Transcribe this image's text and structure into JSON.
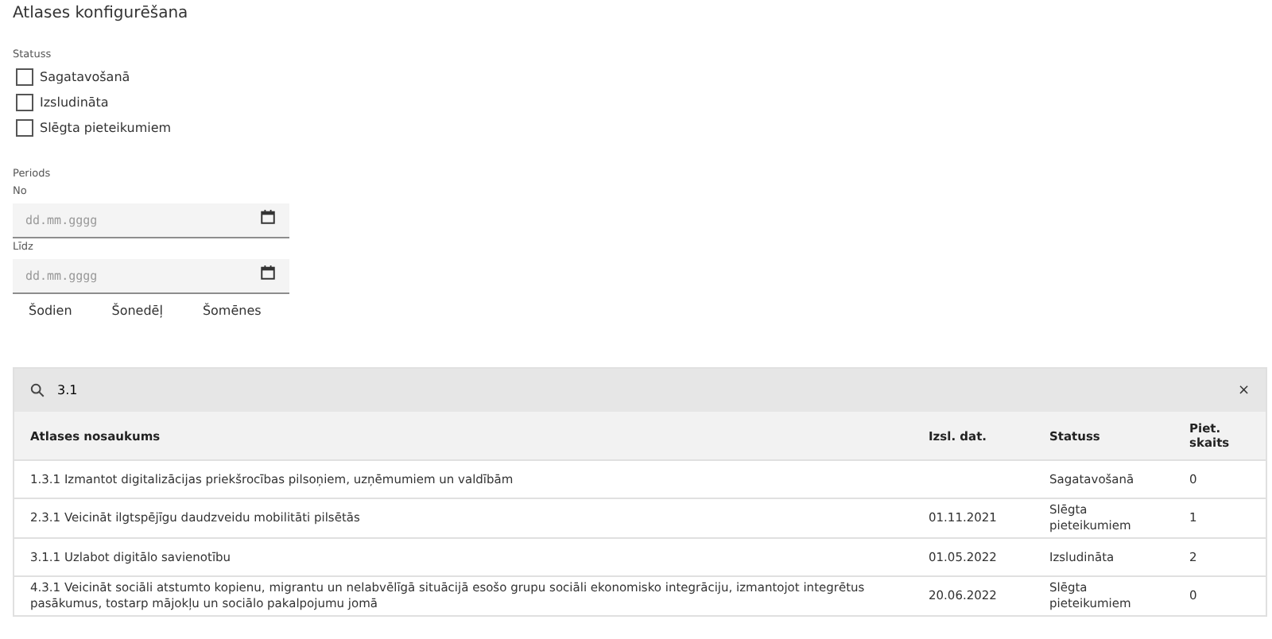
{
  "title": "Atlases konfigurēšana",
  "status_filter": {
    "label": "Statuss",
    "options": [
      {
        "label": "Sagatavošanā",
        "checked": false
      },
      {
        "label": "Izsludināta",
        "checked": false
      },
      {
        "label": "Slēgta pieteikumiem",
        "checked": false
      }
    ]
  },
  "period": {
    "label": "Periods",
    "fields": [
      {
        "label": "No",
        "placeholder": "dd.mm.gggg"
      },
      {
        "label": "Līdz",
        "placeholder": "dd.mm.gggg"
      }
    ],
    "quick_buttons": [
      "Šodien",
      "Šonedēļ",
      "Šomēnes"
    ]
  },
  "search": {
    "value": "3.1",
    "clear": "×"
  },
  "table": {
    "columns": [
      "Atlases nosaukums",
      "Izsl. dat.",
      "Statuss",
      "Piet. skaits"
    ],
    "rows": [
      {
        "name": "1.3.1 Izmantot digitalizācijas priekšrocības pilsoņiem, uzņēmumiem un valdībām",
        "date": "",
        "status": "Sagatavošanā",
        "count": "0"
      },
      {
        "name": "2.3.1 Veicināt ilgtspējīgu daudzveidu mobilitāti pilsētās",
        "date": "01.11.2021",
        "status": "Slēgta pieteikumiem",
        "count": "1"
      },
      {
        "name": "3.1.1 Uzlabot digitālo savienotību",
        "date": "01.05.2022",
        "status": "Izsludināta",
        "count": "2"
      },
      {
        "name": "4.3.1 Veicināt sociāli atstumto kopienu, migrantu un nelabvēlīgā situācijā esošo grupu sociāli ekonomisko integrāciju, izmantojot integrētus pasākumus, tostarp mājokļu un sociālo pakalpojumu jomā",
        "date": "20.06.2022",
        "status": "Slēgta pieteikumiem",
        "count": "0"
      }
    ]
  }
}
